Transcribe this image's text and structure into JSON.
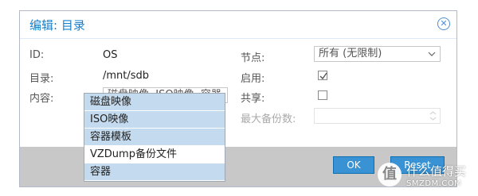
{
  "dialog": {
    "title": "编辑: 目录",
    "close_icon": "close-circle-icon"
  },
  "form": {
    "id_label": "ID:",
    "id_value": "OS",
    "dir_label": "目录:",
    "dir_value": "/mnt/sdb",
    "content_label": "内容:",
    "content_value": "磁盘映像, ISO映像, 容器",
    "nodes_label": "节点:",
    "nodes_value": "所有 (无限制)",
    "enable_label": "启用:",
    "enable_checked": true,
    "shared_label": "共享:",
    "shared_checked": false,
    "max_backups_label": "最大备份数:"
  },
  "content_options": [
    {
      "label": "磁盘映像",
      "selected": true
    },
    {
      "label": "ISO映像",
      "selected": true
    },
    {
      "label": "容器模板",
      "selected": true
    },
    {
      "label": "VZDump备份文件",
      "selected": false
    },
    {
      "label": "容器",
      "selected": true
    }
  ],
  "buttons": {
    "ok": "OK",
    "reset": "Reset"
  },
  "colors": {
    "accent": "#157fcc",
    "button_bg": "#3892d4",
    "selected_item_bg": "#c4dbef",
    "footer_bg": "#c8c8c8"
  },
  "watermark": {
    "logo_glyph": "值",
    "text": "什么值得买",
    "subtext": "SMZDM.COM"
  }
}
